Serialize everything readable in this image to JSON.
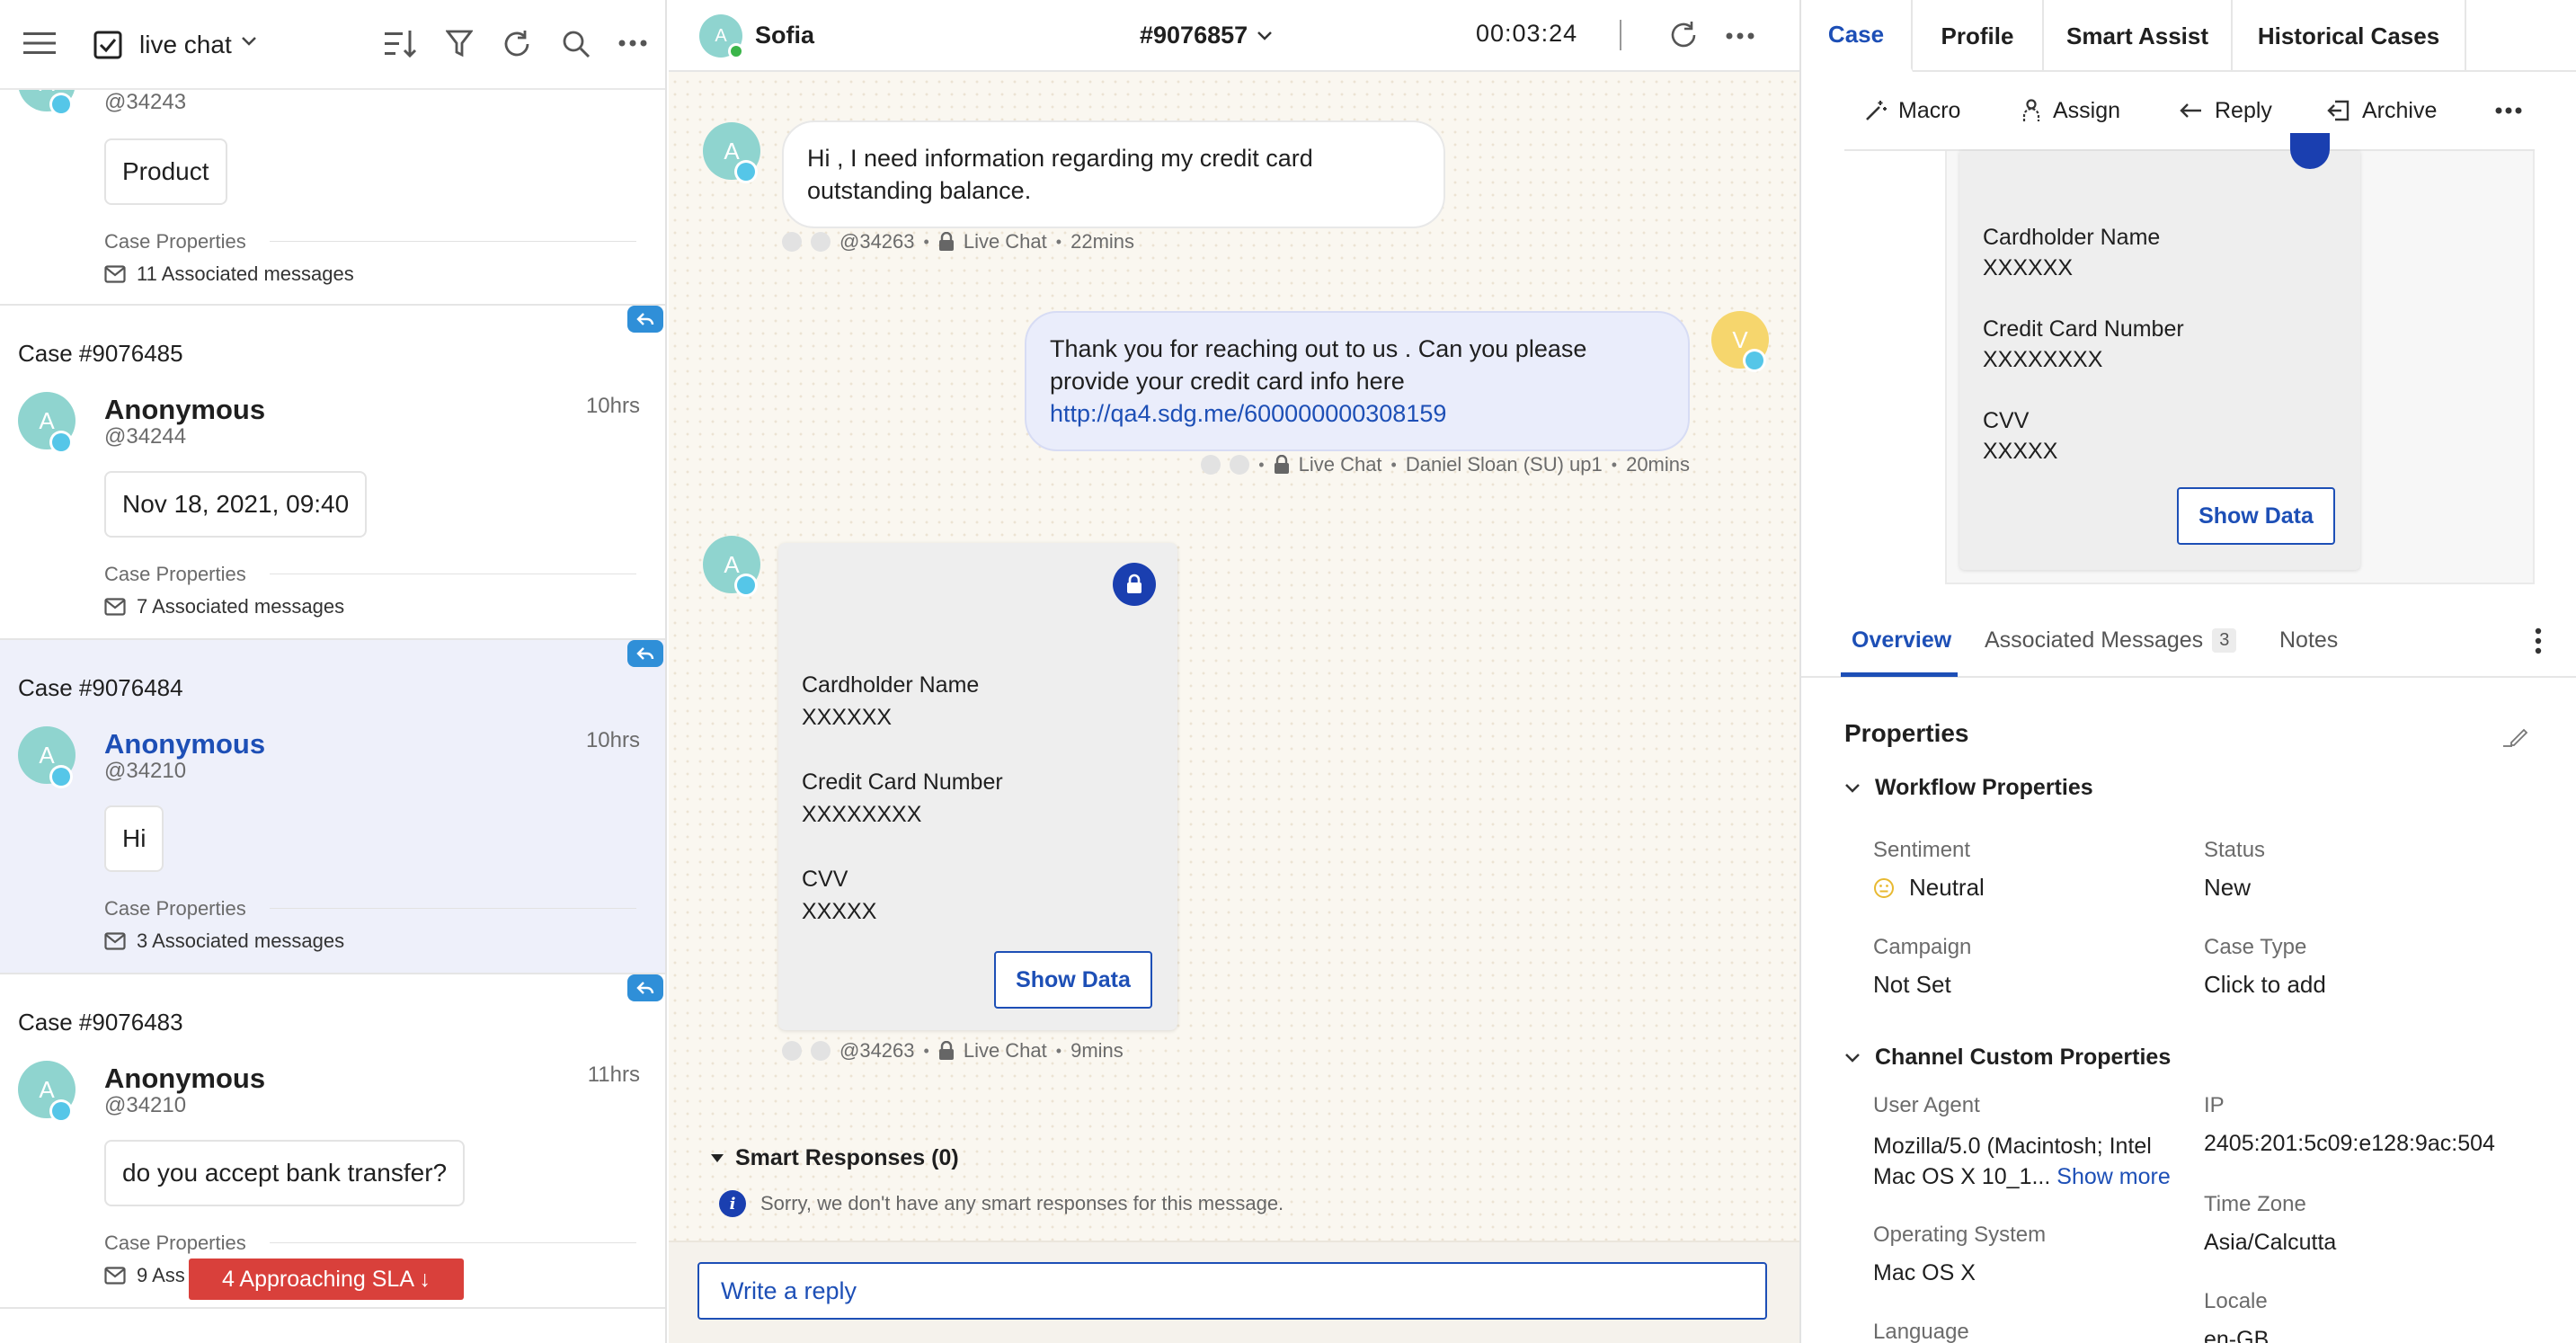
{
  "left": {
    "header": {
      "title": "live chat"
    },
    "cards": [
      {
        "case": "",
        "name": "",
        "handle": "@34243",
        "time": "",
        "message": "Product",
        "props_label": "Case Properties",
        "assoc": "11 Associated messages"
      },
      {
        "case": "Case #9076485",
        "name": "Anonymous",
        "handle": "@34244",
        "time": "10hrs",
        "message": "Nov 18, 2021, 09:40",
        "props_label": "Case Properties",
        "assoc": "7 Associated messages"
      },
      {
        "case": "Case #9076484",
        "name": "Anonymous",
        "handle": "@34210",
        "time": "10hrs",
        "message": "Hi",
        "props_label": "Case Properties",
        "assoc": "3 Associated messages"
      },
      {
        "case": "Case #9076483",
        "name": "Anonymous",
        "handle": "@34210",
        "time": "11hrs",
        "message": "do you accept bank transfer?",
        "props_label": "Case Properties",
        "assoc": "9 Ass"
      }
    ],
    "avatar_letter": "A",
    "sla_banner": "4 Approaching SLA ↓"
  },
  "middle": {
    "header": {
      "agent": "Sofia",
      "case_id": "#9076857",
      "timer": "00:03:24",
      "avatar_letter": "A"
    },
    "messages": [
      {
        "text": "Hi , I need information regarding my credit card outstanding balance.",
        "handle": "@34263",
        "channel": "Live Chat",
        "time": "22mins"
      },
      {
        "text": "Thank you for reaching out to us . Can you please provide your credit card info here",
        "link": "http://qa4.sdg.me/600000000308159",
        "channel": "Live Chat",
        "agent": "Daniel Sloan (SU) up1",
        "time": "20mins",
        "avatar_letter": "V"
      },
      {
        "handle": "@34263",
        "channel": "Live Chat",
        "time": "9mins"
      }
    ],
    "secure_card": {
      "cardholder_label": "Cardholder Name",
      "cardholder_value": "XXXXXX",
      "cc_label": "Credit Card Number",
      "cc_value": "XXXXXXXX",
      "cvv_label": "CVV",
      "cvv_value": "XXXXX",
      "button": "Show Data"
    },
    "smart_responses": {
      "title": "Smart Responses (0)",
      "empty": "Sorry, we don't have any smart responses for this message."
    },
    "reply_placeholder": "Write a reply"
  },
  "right": {
    "tabs": [
      "Case",
      "Profile",
      "Smart Assist",
      "Historical Cases"
    ],
    "actions": [
      "Macro",
      "Assign",
      "Reply",
      "Archive"
    ],
    "secure_card": {
      "cardholder_label": "Cardholder Name",
      "cardholder_value": "XXXXXX",
      "cc_label": "Credit Card Number",
      "cc_value": "XXXXXXXX",
      "cvv_label": "CVV",
      "cvv_value": "XXXXX",
      "button": "Show Data"
    },
    "subtabs": {
      "overview": "Overview",
      "assoc": "Associated Messages",
      "assoc_count": "3",
      "notes": "Notes"
    },
    "properties_title": "Properties",
    "workflow": {
      "title": "Workflow Properties",
      "sentiment_label": "Sentiment",
      "sentiment_value": "Neutral",
      "status_label": "Status",
      "status_value": "New",
      "campaign_label": "Campaign",
      "campaign_value": "Not Set",
      "casetype_label": "Case Type",
      "casetype_value": "Click to add"
    },
    "channel": {
      "title": "Channel Custom Properties",
      "ua_label": "User Agent",
      "ua_value_1": "Mozilla/5.0 (Macintosh; Intel",
      "ua_value_2": "Mac OS X 10_1...",
      "show_more": "Show more",
      "ip_label": "IP",
      "ip_value": "2405:201:5c09:e128:9ac:504",
      "tz_label": "Time Zone",
      "tz_value": "Asia/Calcutta",
      "os_label": "Operating System",
      "os_value": "Mac OS X",
      "locale_label": "Locale",
      "locale_value": "en-GB",
      "lang_label": "Language"
    }
  },
  "colors": {
    "accent": "#1d4fb6",
    "sla_red": "#d9403b",
    "avatar_teal": "#8fd4cf",
    "avatar_yellow": "#f6d66d"
  }
}
